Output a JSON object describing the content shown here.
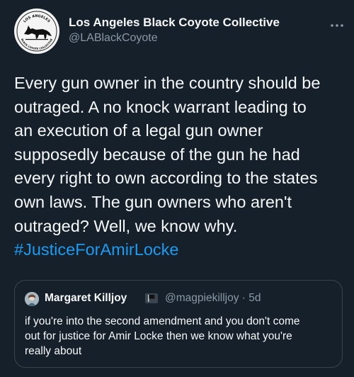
{
  "author": {
    "name": "Los Angeles Black Coyote Collective",
    "handle": "@LABlackCoyote",
    "avatar_icon": "coyote-logo-icon",
    "avatar_text_top": "LOS ANGELES",
    "avatar_text_bottom": "BLACK COYOTE COLLECTIVE"
  },
  "more_icon": "more-options-icon",
  "tweet": {
    "lines": [
      "Every gun owner in the country should be",
      "outraged. A no knock warrant leading to",
      "an execution of a legal gun owner",
      "supposedly because of the gun he had",
      "every right to own according to the states",
      "own laws. The gun owners who aren't",
      "outraged? Well, we know why."
    ],
    "hashtag": "#JusticeForAmirLocke"
  },
  "quote": {
    "name": "Margaret Killjoy",
    "flag_icon": "black-flag-icon",
    "handle": "@magpiekilljoy",
    "separator": "·",
    "time": "5d",
    "lines": [
      "if you're into the second amendment and you don't come",
      "out for justice for Amir Locke then we know what you're",
      "really about"
    ]
  },
  "colors": {
    "background": "#15202b",
    "text": "#f7f9f9",
    "secondary": "#8b98a5",
    "link": "#1d9bf0",
    "border": "#38444d"
  }
}
